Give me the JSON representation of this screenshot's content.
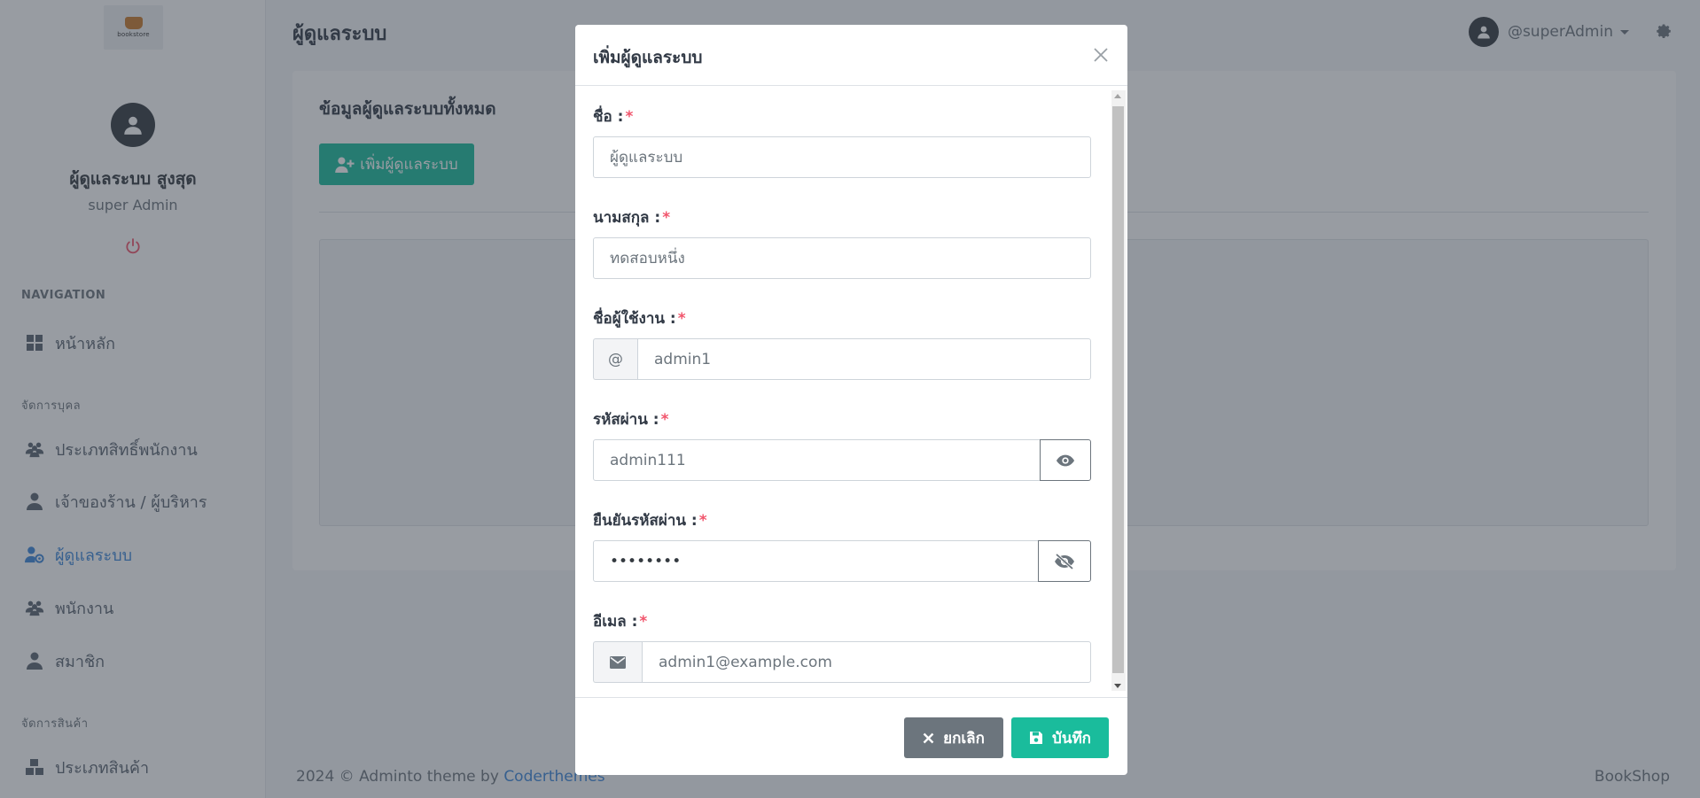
{
  "sidebar": {
    "logo_text": "bookstore",
    "user_name": "ผู้ดูแลระบบ สูงสุด",
    "user_role": "super Admin",
    "sections": {
      "navigation": "NAVIGATION",
      "people": "จัดการบุคล",
      "products": "จัดการสินค้า"
    },
    "items": {
      "home": "หน้าหลัก",
      "roles": "ประเภทสิทธิ์พนักงาน",
      "owners": "เจ้าของร้าน / ผู้บริหาร",
      "admins": "ผู้ดูแลระบบ",
      "employees": "พนักงาน",
      "members": "สมาชิก",
      "product_types": "ประเภทสินค้า"
    }
  },
  "topbar": {
    "page_title": "ผู้ดูแลระบบ",
    "username": "@superAdmin"
  },
  "card": {
    "title": "ข้อมูลผู้ดูแลระบบทั้งหมด",
    "add_button": "เพิ่มผู้ดูแลระบบ"
  },
  "footer": {
    "copyright": "2024 © Adminto theme by",
    "link": "Coderthemes",
    "brand": "BookShop"
  },
  "modal": {
    "title": "เพิ่มผู้ดูแลระบบ",
    "fields": {
      "first_name": {
        "label": "ชื่อ :",
        "required": "*",
        "value": "ผู้ดูแลระบบ"
      },
      "last_name": {
        "label": "นามสกุล :",
        "required": "*",
        "value": "ทดสอบหนึ่ง"
      },
      "username": {
        "label": "ชื่อผู้ใช้งาน :",
        "required": "*",
        "prefix": "@",
        "value": "admin1"
      },
      "password": {
        "label": "รหัสผ่าน :",
        "required": "*",
        "value": "admin111"
      },
      "confirm_password": {
        "label": "ยืนยันรหัสผ่าน :",
        "required": "*",
        "value": "••••••••"
      },
      "email": {
        "label": "อีเมล :",
        "required": "*",
        "value": "admin1@example.com"
      }
    },
    "cancel_label": "ยกเลิก",
    "save_label": "บันทึก"
  },
  "colors": {
    "accent": "#1abc9c",
    "active_nav": "#3c86d8",
    "danger": "#f1556c",
    "muted": "#6c757d"
  },
  "icons": {
    "home": "dashboard-grid-icon",
    "roles": "users-icon",
    "owners": "user-tie-icon",
    "admins": "user-gear-icon",
    "employees": "users-icon",
    "members": "user-icon",
    "product_types": "boxes-icon",
    "power": "power-icon",
    "settings": "gear-icon",
    "close": "close-icon",
    "eye": "eye-icon",
    "eye_slash": "eye-slash-icon",
    "email": "envelope-icon",
    "cancel": "x-icon",
    "save": "save-icon",
    "add_user": "user-plus-icon"
  }
}
